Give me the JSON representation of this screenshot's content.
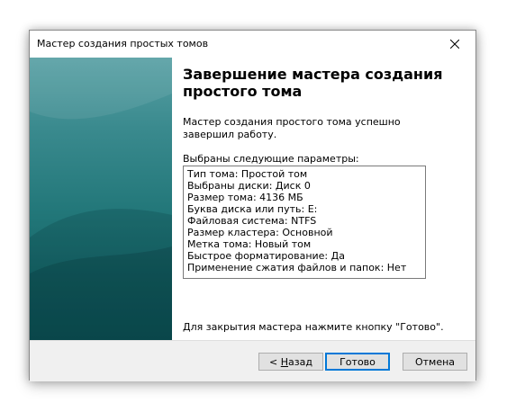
{
  "window": {
    "title": "Мастер создания простых томов",
    "close_icon": "close-icon"
  },
  "page": {
    "heading_line1": "Завершение мастера создания",
    "heading_line2": "простого тома",
    "description": "Мастер создания простого тома успешно завершил работу.",
    "params_label": "Выбраны следующие параметры:",
    "params": [
      "Тип тома: Простой том",
      "Выбраны диски: Диск 0",
      "Размер тома: 4136 МБ",
      "Буква диска или путь: E:",
      "Файловая система: NTFS",
      "Размер кластера: Основной",
      "Метка тома: Новый том",
      "Быстрое форматирование: Да",
      "Применение сжатия файлов и папок: Нет"
    ],
    "finish_hint": "Для закрытия мастера нажмите кнопку \"Готово\"."
  },
  "buttons": {
    "back_prefix": "< ",
    "back_mnemonic": "Н",
    "back_rest": "азад",
    "finish": "Готово",
    "cancel": "Отмена"
  },
  "colors": {
    "sidebar_top": "#58a0a4",
    "sidebar_bottom": "#0f5a5d",
    "default_button_border": "#0078d7"
  }
}
